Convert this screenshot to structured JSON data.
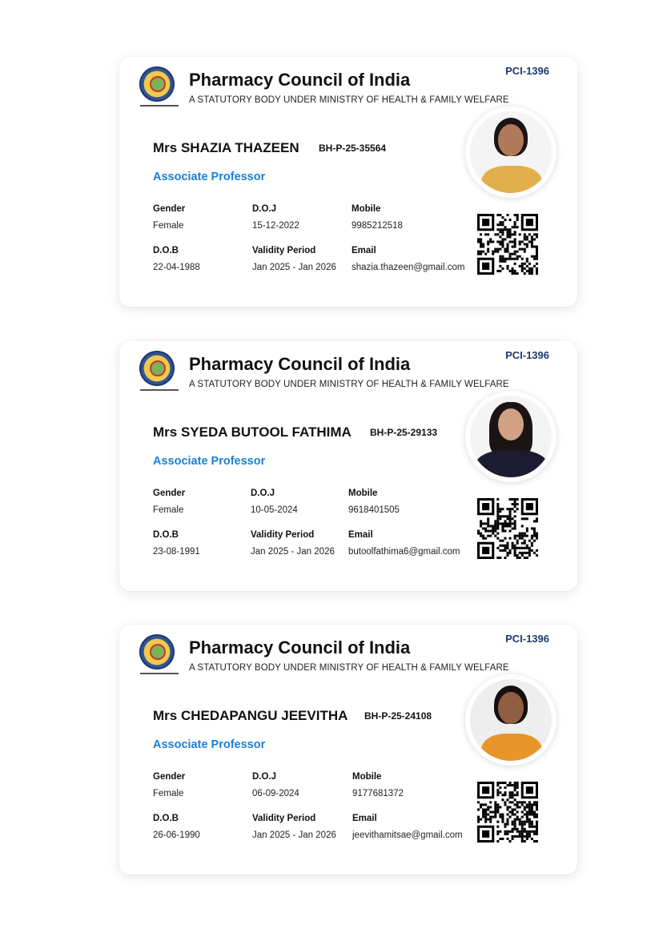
{
  "cards": [
    {
      "org_title": "Pharmacy Council of India",
      "org_subtitle": "A STATUTORY BODY UNDER MINISTRY OF HEALTH & FAMILY WELFARE",
      "code": "PCI-1396",
      "name": "Mrs SHAZIA THAZEEN",
      "reg_no": "BH-P-25-35564",
      "designation": "Associate Professor",
      "fields": {
        "gender_label": "Gender",
        "gender": "Female",
        "doj_label": "D.O.J",
        "doj": "15-12-2022",
        "mobile_label": "Mobile",
        "mobile": "9985212518",
        "dob_label": "D.O.B",
        "dob": "22-04-1988",
        "validity_label": "Validity Period",
        "validity": "Jan 2025 - Jan 2026",
        "email_label": "Email",
        "email": "shazia.thazeen@gmail.com"
      }
    },
    {
      "org_title": "Pharmacy Council of India",
      "org_subtitle": "A STATUTORY BODY UNDER MINISTRY OF HEALTH & FAMILY WELFARE",
      "code": "PCI-1396",
      "name": "Mrs SYEDA BUTOOL FATHIMA",
      "reg_no": "BH-P-25-29133",
      "designation": "Associate Professor",
      "fields": {
        "gender_label": "Gender",
        "gender": "Female",
        "doj_label": "D.O.J",
        "doj": "10-05-2024",
        "mobile_label": "Mobile",
        "mobile": "9618401505",
        "dob_label": "D.O.B",
        "dob": "23-08-1991",
        "validity_label": "Validity Period",
        "validity": "Jan 2025 - Jan 2026",
        "email_label": "Email",
        "email": "butoolfathima6@gmail.com"
      }
    },
    {
      "org_title": "Pharmacy Council of India",
      "org_subtitle": "A STATUTORY BODY UNDER MINISTRY OF HEALTH & FAMILY WELFARE",
      "code": "PCI-1396",
      "name": "Mrs CHEDAPANGU JEEVITHA",
      "reg_no": "BH-P-25-24108",
      "designation": "Associate Professor",
      "fields": {
        "gender_label": "Gender",
        "gender": "Female",
        "doj_label": "D.O.J",
        "doj": "06-09-2024",
        "mobile_label": "Mobile",
        "mobile": "9177681372",
        "dob_label": "D.O.B",
        "dob": "26-06-1990",
        "validity_label": "Validity Period",
        "validity": "Jan 2025 - Jan 2026",
        "email_label": "Email",
        "email": "jeevithamitsae@gmail.com"
      }
    }
  ],
  "colors": {
    "accent": "#1a7fd6",
    "code": "#1f3a6b"
  },
  "icons": {
    "logo": "pci-emblem-icon",
    "qr": "qr-code-icon",
    "photo": "profile-photo"
  }
}
